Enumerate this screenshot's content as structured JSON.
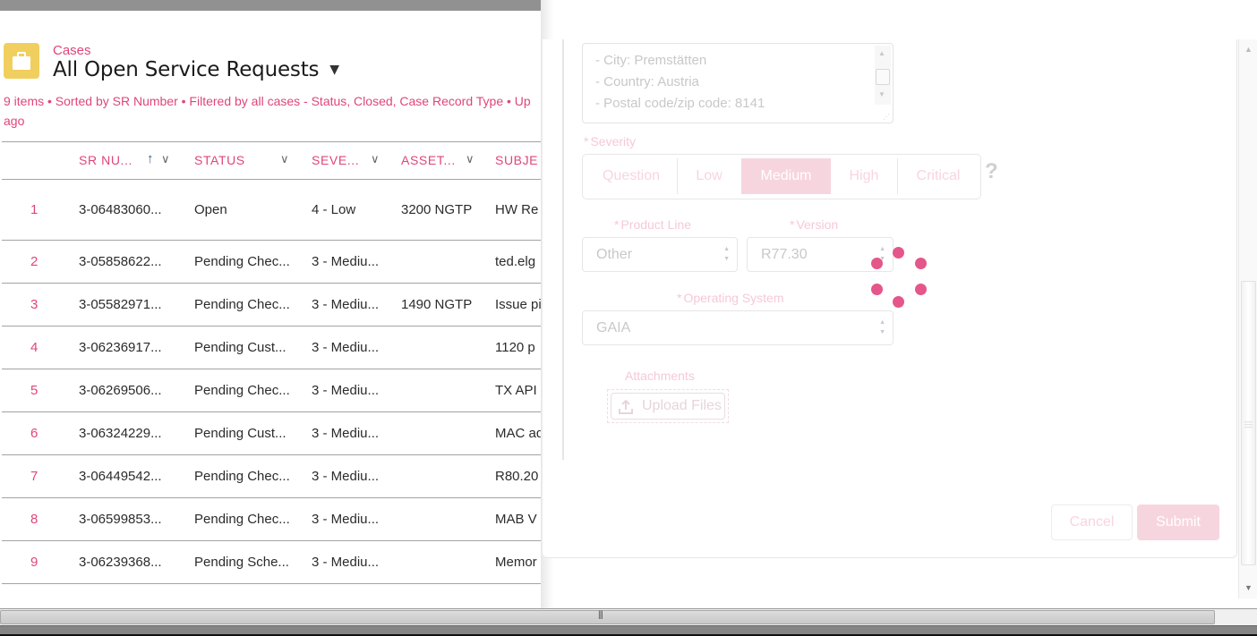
{
  "list": {
    "object_label": "Cases",
    "title": "All Open Service Requests",
    "title_dropdown_icon": "caret-down-icon",
    "object_icon": "briefcase-icon",
    "meta": "9 items • Sorted by SR Number • Filtered by all cases - Status, Closed, Case Record Type • Up",
    "meta_line2": "ago",
    "columns": [
      {
        "label": "SR NU...",
        "sorted": "ascending"
      },
      {
        "label": "STATUS"
      },
      {
        "label": "SEVE..."
      },
      {
        "label": "ASSET..."
      },
      {
        "label": "SUBJE"
      }
    ],
    "rows": [
      {
        "num": "1",
        "sr": "3-06483060...",
        "status": "Open",
        "severity": "4 - Low",
        "asset": "3200 NGTP",
        "subject": "HW Re"
      },
      {
        "num": "2",
        "sr": "3-05858622...",
        "status": "Pending Chec...",
        "severity": "3 - Mediu...",
        "asset": "",
        "subject": "ted.elg"
      },
      {
        "num": "3",
        "sr": "3-05582971...",
        "status": "Pending Chec...",
        "severity": "3 - Mediu...",
        "asset": "1490 NGTP",
        "subject": "Issue pi"
      },
      {
        "num": "4",
        "sr": "3-06236917...",
        "status": "Pending Cust...",
        "severity": "3 - Mediu...",
        "asset": "",
        "subject": "1120 p"
      },
      {
        "num": "5",
        "sr": "3-06269506...",
        "status": "Pending Chec...",
        "severity": "3 - Mediu...",
        "asset": "",
        "subject": "TX API"
      },
      {
        "num": "6",
        "sr": "3-06324229...",
        "status": "Pending Cust...",
        "severity": "3 - Mediu...",
        "asset": "",
        "subject": "MAC ad"
      },
      {
        "num": "7",
        "sr": "3-06449542...",
        "status": "Pending Chec...",
        "severity": "3 - Mediu...",
        "asset": "",
        "subject": "R80.20"
      },
      {
        "num": "8",
        "sr": "3-06599853...",
        "status": "Pending Chec...",
        "severity": "3 - Mediu...",
        "asset": "",
        "subject": "MAB V"
      },
      {
        "num": "9",
        "sr": "3-06239368...",
        "status": "Pending Sche...",
        "severity": "3 - Mediu...",
        "asset": "",
        "subject": "Memor"
      }
    ]
  },
  "form": {
    "address_lines": [
      "- City: Premstätten",
      "- Country: Austria",
      "- Postal code/zip code: 8141"
    ],
    "severity": {
      "label": "Severity",
      "required_mark": "*",
      "options": [
        "Question",
        "Low",
        "Medium",
        "High",
        "Critical"
      ],
      "selected": "Medium",
      "help": "?"
    },
    "product_line": {
      "label": "Product Line",
      "required_mark": "*",
      "value": "Other"
    },
    "version": {
      "label": "Version",
      "required_mark": "*",
      "value": "R77.30"
    },
    "operating_system": {
      "label": "Operating System",
      "required_mark": "*",
      "value": "GAIA"
    },
    "attachments": {
      "label": "Attachments",
      "upload_label": "Upload Files"
    },
    "cancel_label": "Cancel",
    "submit_label": "Submit",
    "loading": true
  },
  "colors": {
    "accent": "#e0457b",
    "spinner": "#e5568a",
    "object_icon_bg": "#f1cf5f",
    "selected_segment": "#f7d5df"
  }
}
